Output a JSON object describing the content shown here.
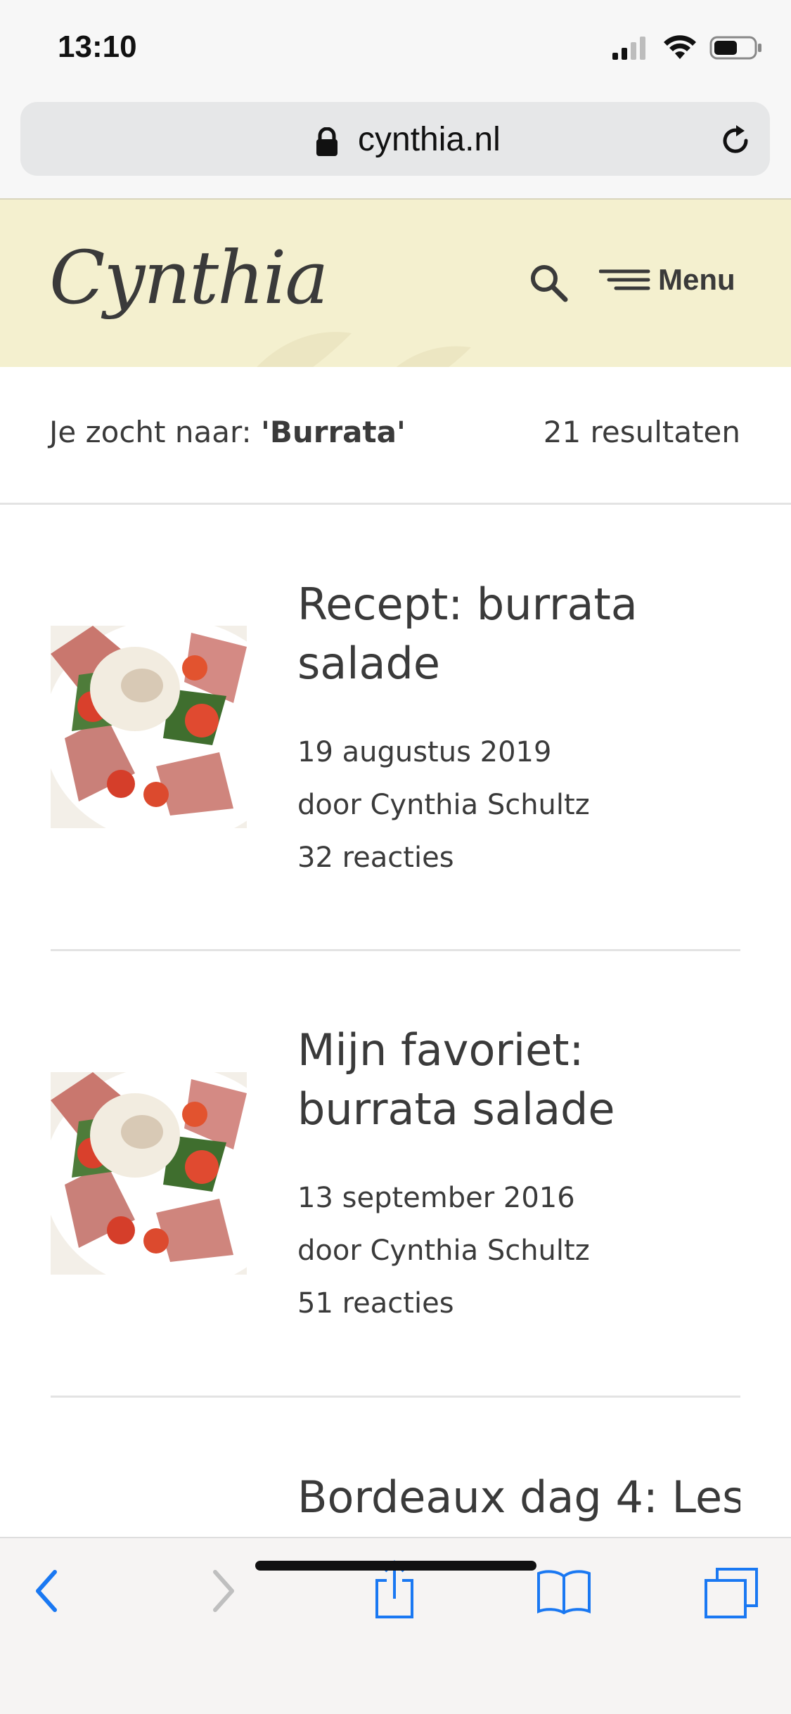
{
  "status_bar": {
    "time": "13:10"
  },
  "address_bar": {
    "url": "cynthia.nl"
  },
  "site_header": {
    "logo_text": "Cynthia",
    "menu_label": "Menu"
  },
  "search_summary": {
    "prefix": "Je zocht naar: ",
    "query": "'Burrata'",
    "count": "21 resultaten"
  },
  "results": [
    {
      "title": "Recept: burrata salade",
      "date": "19 augustus 2019",
      "author": "door Cynthia Schultz",
      "comments": "32 reacties"
    },
    {
      "title": "Mijn favoriet: burrata salade",
      "date": "13 september 2016",
      "author": "door Cynthia Schultz",
      "comments": "51 reacties"
    },
    {
      "title": "Bordeaux dag 4: Les"
    }
  ],
  "toolbar": {
    "back_icon": "chevron-left-icon",
    "forward_icon": "chevron-right-icon",
    "share_icon": "share-icon",
    "bookmarks_icon": "book-icon",
    "tabs_icon": "tabs-icon"
  },
  "colors": {
    "header_bg": "#f4f0cf",
    "text": "#3a3a3a",
    "ios_blue": "#1a78f2"
  }
}
